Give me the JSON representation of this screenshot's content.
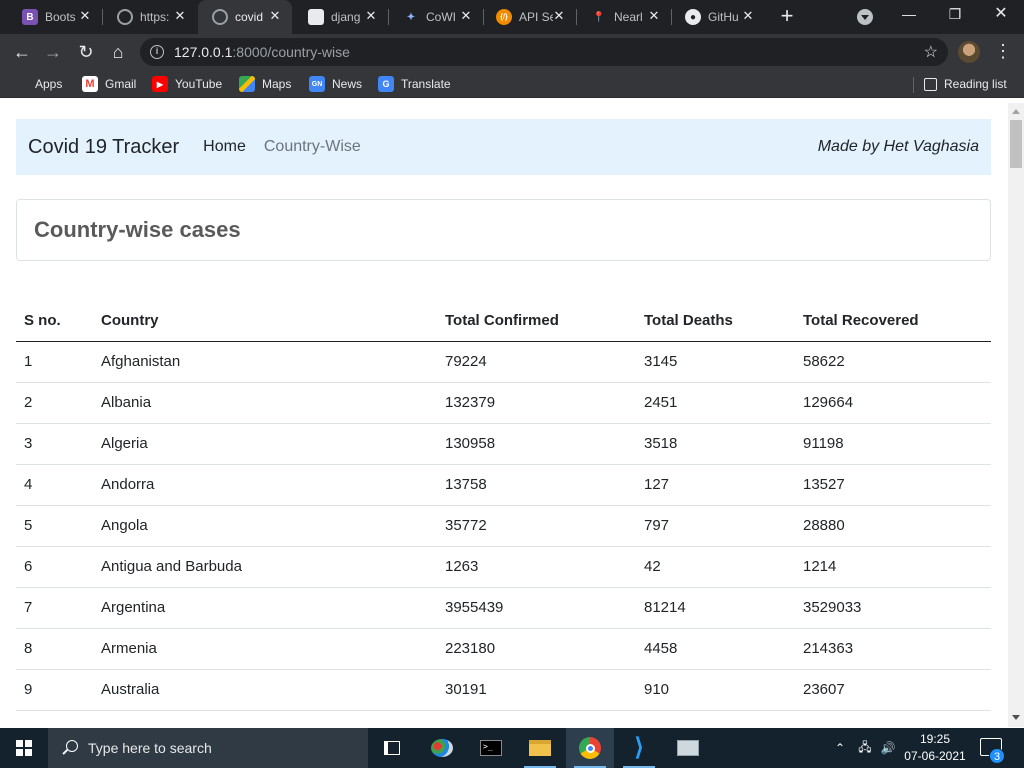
{
  "browser": {
    "tabs": [
      {
        "title": "Boots",
        "icon": "bootstrap-icon",
        "color": "#7952b3",
        "glyph": "B"
      },
      {
        "title": "https:",
        "icon": "globe-icon",
        "color": "#5f6368",
        "glyph": ""
      },
      {
        "title": "covid",
        "icon": "globe-icon",
        "color": "#5f6368",
        "glyph": "",
        "active": true
      },
      {
        "title": "djang",
        "icon": "cube-icon",
        "color": "#e8eaed",
        "glyph": ""
      },
      {
        "title": "CoWI",
        "icon": "sparkle-icon",
        "color": "#35363a",
        "glyph": "✦"
      },
      {
        "title": "API Se",
        "icon": "api-icon",
        "color": "#f28b00",
        "glyph": "{/}"
      },
      {
        "title": "Nearl",
        "icon": "map-pin-icon",
        "color": "#202124",
        "glyph": "📍"
      },
      {
        "title": "GitHu",
        "icon": "github-icon",
        "color": "#e8eaed",
        "glyph": "●"
      }
    ],
    "close_glyph": "✕",
    "new_tab_glyph": "+",
    "address": {
      "host": "127.0.0.1",
      "rest": ":8000/country-wise"
    },
    "bookmarks": [
      {
        "label": "Apps",
        "icon": "apps-grid-icon"
      },
      {
        "label": "Gmail",
        "icon": "gmail-icon"
      },
      {
        "label": "YouTube",
        "icon": "youtube-icon"
      },
      {
        "label": "Maps",
        "icon": "maps-icon"
      },
      {
        "label": "News",
        "icon": "news-icon"
      },
      {
        "label": "Translate",
        "icon": "translate-icon"
      }
    ],
    "reading_list": "Reading list"
  },
  "page": {
    "brand": "Covid 19 Tracker",
    "nav": [
      {
        "label": "Home"
      },
      {
        "label": "Country-Wise"
      }
    ],
    "made_by": "Made by Het Vaghasia",
    "heading": "Country-wise cases",
    "table": {
      "headers": [
        "S no.",
        "Country",
        "Total Confirmed",
        "Total Deaths",
        "Total Recovered"
      ],
      "rows": [
        [
          "1",
          "Afghanistan",
          "79224",
          "3145",
          "58622"
        ],
        [
          "2",
          "Albania",
          "132379",
          "2451",
          "129664"
        ],
        [
          "3",
          "Algeria",
          "130958",
          "3518",
          "91198"
        ],
        [
          "4",
          "Andorra",
          "13758",
          "127",
          "13527"
        ],
        [
          "5",
          "Angola",
          "35772",
          "797",
          "28880"
        ],
        [
          "6",
          "Antigua and Barbuda",
          "1263",
          "42",
          "1214"
        ],
        [
          "7",
          "Argentina",
          "3955439",
          "81214",
          "3529033"
        ],
        [
          "8",
          "Armenia",
          "223180",
          "4458",
          "214363"
        ],
        [
          "9",
          "Australia",
          "30191",
          "910",
          "23607"
        ]
      ]
    }
  },
  "taskbar": {
    "search_placeholder": "Type here to search",
    "time": "19:25",
    "date": "07-06-2021",
    "notification_count": "3"
  }
}
